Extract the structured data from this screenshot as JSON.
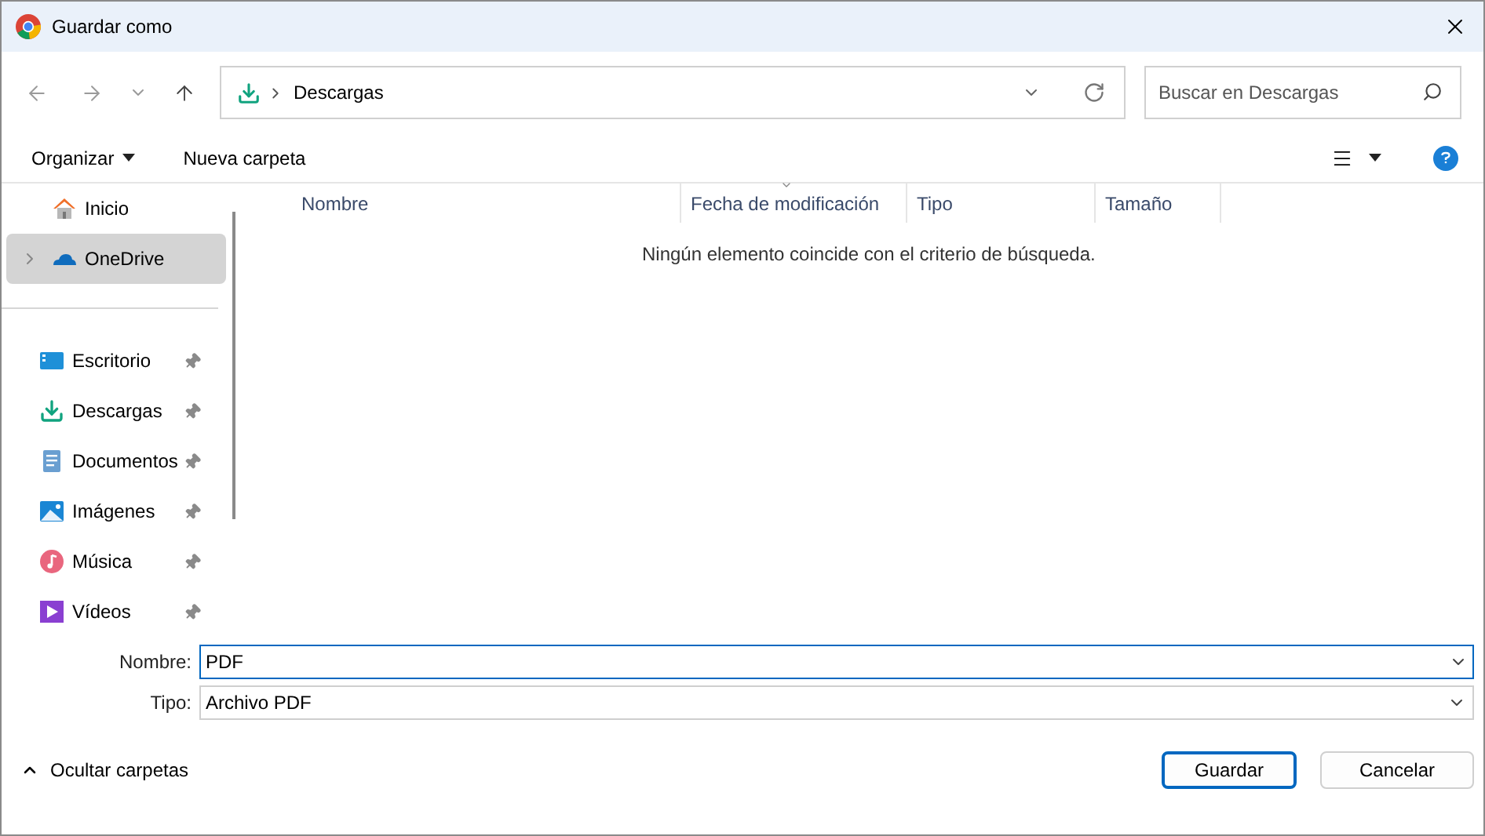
{
  "window": {
    "title": "Guardar como"
  },
  "address_bar": {
    "path": "Descargas"
  },
  "search": {
    "placeholder": "Buscar en Descargas"
  },
  "toolbar": {
    "organize": "Organizar",
    "new_folder": "Nueva carpeta"
  },
  "sidebar": {
    "groups": [
      {
        "items": [
          {
            "label": "Inicio",
            "kind": "home",
            "selected": false,
            "pinned": false,
            "expandable": false
          },
          {
            "label": "OneDrive",
            "kind": "cloud",
            "selected": true,
            "pinned": false,
            "expandable": true
          }
        ]
      },
      {
        "items": [
          {
            "label": "Escritorio",
            "kind": "desktop",
            "selected": false,
            "pinned": true,
            "expandable": false
          },
          {
            "label": "Descargas",
            "kind": "download",
            "selected": false,
            "pinned": true,
            "expandable": false
          },
          {
            "label": "Documentos",
            "kind": "document",
            "selected": false,
            "pinned": true,
            "expandable": false
          },
          {
            "label": "Imágenes",
            "kind": "image",
            "selected": false,
            "pinned": true,
            "expandable": false
          },
          {
            "label": "Música",
            "kind": "music",
            "selected": false,
            "pinned": true,
            "expandable": false
          },
          {
            "label": "Vídeos",
            "kind": "video",
            "selected": false,
            "pinned": true,
            "expandable": false
          }
        ]
      }
    ]
  },
  "table": {
    "columns": [
      {
        "label": "Nombre",
        "sorted": false
      },
      {
        "label": "Fecha de modificación",
        "sorted": true
      },
      {
        "label": "Tipo",
        "sorted": false
      },
      {
        "label": "Tamaño",
        "sorted": false
      }
    ],
    "empty_message": "Ningún elemento coincide con el criterio de búsqueda."
  },
  "form": {
    "name_label": "Nombre:",
    "name_value": "PDF",
    "type_label": "Tipo:",
    "type_value": "Archivo PDF"
  },
  "hide_folders": "Ocultar carpetas",
  "buttons": [
    {
      "label": "Guardar",
      "primary": true
    },
    {
      "label": "Cancelar",
      "primary": false
    }
  ]
}
